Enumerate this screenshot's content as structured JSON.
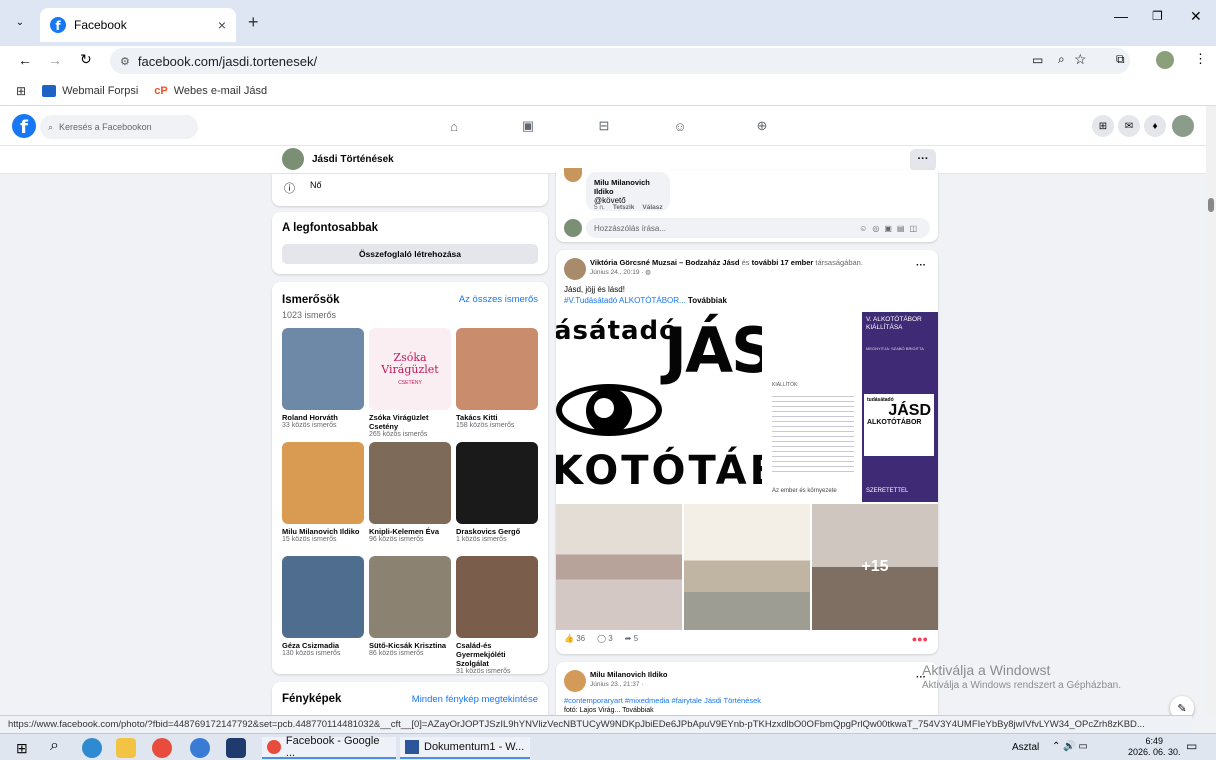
{
  "browser": {
    "tab_title": "Facebook",
    "tab_close": "×",
    "new_tab": "+",
    "url": "facebook.com/jasdi.tortenesek/",
    "bookmarks": [
      "Webmail Forpsi",
      "Webes e-mail Jásd"
    ]
  },
  "fb_nav": {
    "search_placeholder": "Keresés a Facebookon"
  },
  "page_header": {
    "name": "Jásdi Történések",
    "more": "···"
  },
  "intro": {
    "gender": "Nő"
  },
  "highlights": {
    "title": "A legfontosabbak",
    "button": "Összefoglaló létrehozása"
  },
  "friends": {
    "title": "Ismerősök",
    "see_all": "Az összes ismerős",
    "count": "1023 ismerős",
    "items": [
      {
        "name": "Roland Horváth",
        "mutual": "33 közös ismerős",
        "color": "#6e88a8"
      },
      {
        "name": "Zsóka Virágüzlet Csetény",
        "mutual": "265 közös ismerős",
        "color": "#fbeef3"
      },
      {
        "name": "Takács Kitti",
        "mutual": "158 közös ismerős",
        "color": "#c98d6d"
      },
      {
        "name": "Milu Milanovich Ildiko",
        "mutual": "15 közös ismerős",
        "color": "#d99a52"
      },
      {
        "name": "Knipli-Kelemen Éva",
        "mutual": "96 közös ismerős",
        "color": "#7d6a58"
      },
      {
        "name": "Draskovics Gergő",
        "mutual": "1 közös ismerős",
        "color": "#1a1a1a"
      },
      {
        "name": "Géza Csizmadia",
        "mutual": "130 közös ismerős",
        "color": "#4f6d8e"
      },
      {
        "name": "Sütő-Kicsák Krisztina",
        "mutual": "86 közös ismerős",
        "color": "#8c8272"
      },
      {
        "name": "Család-és Gyermekjóléti Szolgálat",
        "mutual": "31 közös ismerős",
        "color": "#7a5d4a"
      }
    ],
    "logo_text": "Zsóka Virágüzlet",
    "logo_sub": "CSETÉNY"
  },
  "photos": {
    "title": "Fényképek",
    "see_all": "Minden fénykép megtekintése"
  },
  "comment_block": {
    "author": "Milu Milanovich Ildiko",
    "text": "@követő",
    "time": "5 n.",
    "like": "Tetszik",
    "reply": "Válasz",
    "write_placeholder": "Hozzászólás írása..."
  },
  "post1": {
    "author": "Viktória Görcsné Muzsai",
    "with_text": " – Bodzaház Jásd ",
    "and": "és",
    "others": "további 17 ember",
    "suffix": " társaságában.",
    "date": "Június 24., 20:19 · ",
    "line1": "Jásd, jöjj és lásd!",
    "line2": "#V.Tudásátadó ALKOTÓTÁBOR... ",
    "more": "Továbbiak",
    "poster_top": "ásátadó",
    "poster_jas": "JÁS",
    "poster_bottom": "KOTÓTÁBO",
    "poster2_title": "V. ALKOTÓTÁBOR KIÁLLÍTÁSA",
    "poster2_small": "MEGNYITJA: SZABÓ BRIGITTA",
    "poster2_kiallitok": "KIÁLLÍTÓK:",
    "poster2_logo_top": "tudásátadó",
    "poster2_logo_jasd": "JÁSD",
    "poster2_logo_sub": "ALKOTÓTÁBOR",
    "poster2_footer": "Az ember és környezete",
    "poster2_sz": "SZERETETTEL",
    "plus": "+15",
    "likes": "36",
    "comments": "3",
    "shares": "5"
  },
  "post2": {
    "author": "Milu Milanovich Ildiko",
    "date": "Június 23., 21:37 · ",
    "tags": "#contemporaryart #mixedmedia #fairytale Jásdi Történések",
    "photo_credit": "fotó: Lajos Virág... Továbbiak"
  },
  "watermark": {
    "title": "Aktiválja a Windowst",
    "sub": "Aktiválja a Windows rendszert a Gépházban."
  },
  "status_url": "https://www.facebook.com/photo/?fbid=448769172147792&set=pcb.448770114481032&__cft__[0]=AZayOrJOPTJSzIL9hYNVlizVecNBTUCyW9NDKpJbiEDe6JPbApuV9EYnb-pTKHzxdlbO0OFbmQpgPrlQw00tkwaT_754V3Y4UMFIeYbBy8jwIVfvLYW34_OPcZrh8zKBD...",
  "taskbar": {
    "apps": [
      "Facebook - Google ...",
      "Dokumentum1 - W..."
    ],
    "desktop": "Asztal",
    "time": "6:49",
    "date": "2026. 06. 30."
  },
  "colors": {
    "fb_blue": "#1877f2",
    "purple": "#3e2a75"
  }
}
